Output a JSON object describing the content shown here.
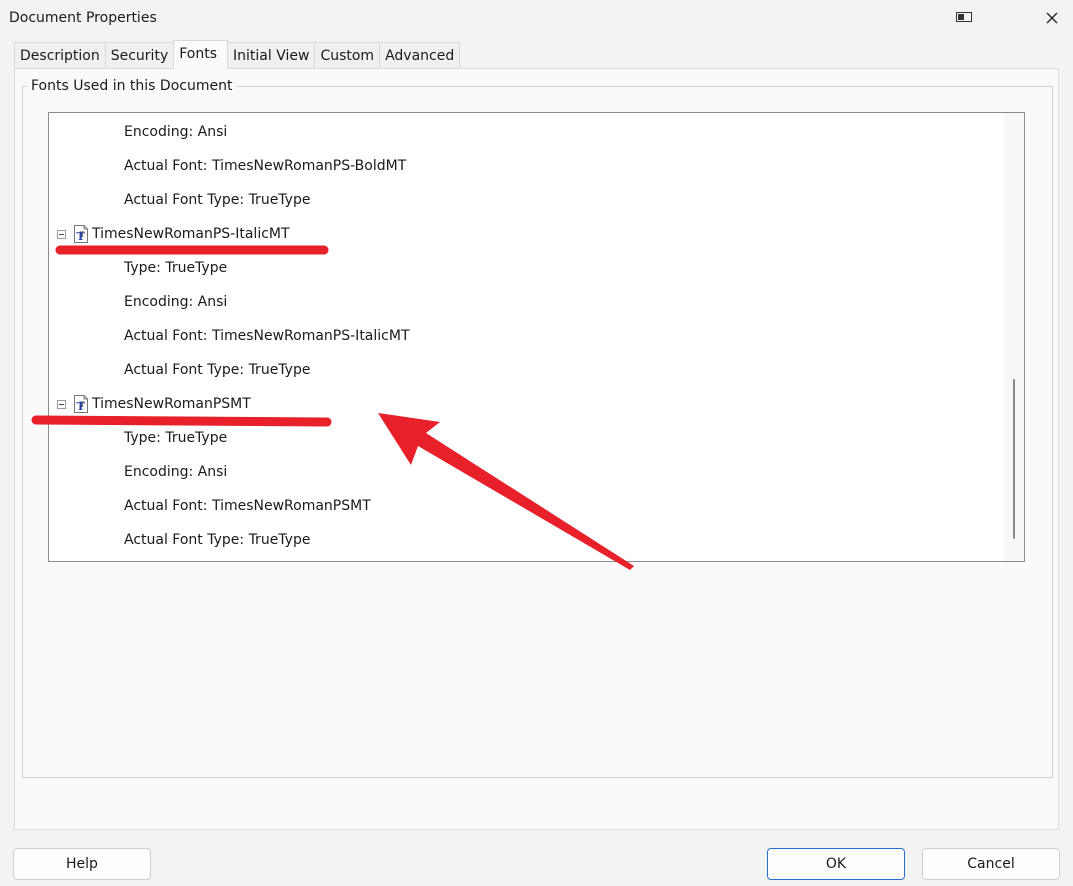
{
  "window": {
    "title": "Document Properties"
  },
  "tabs": [
    {
      "label": "Description"
    },
    {
      "label": "Security"
    },
    {
      "label": "Fonts"
    },
    {
      "label": "Initial View"
    },
    {
      "label": "Custom"
    },
    {
      "label": "Advanced"
    }
  ],
  "active_tab": "Fonts",
  "group": {
    "legend": "Fonts Used in this Document"
  },
  "tree": {
    "rows": [
      {
        "kind": "child",
        "text": "Encoding: Ansi"
      },
      {
        "kind": "child",
        "text": "Actual Font: TimesNewRomanPS-BoldMT"
      },
      {
        "kind": "child",
        "text": "Actual Font Type: TrueType"
      },
      {
        "kind": "parent",
        "text": "TimesNewRomanPS-ItalicMT",
        "expander": "collapse-icon",
        "icon": "truetype-font-icon"
      },
      {
        "kind": "child",
        "text": "Type: TrueType"
      },
      {
        "kind": "child",
        "text": "Encoding: Ansi"
      },
      {
        "kind": "child",
        "text": "Actual Font: TimesNewRomanPS-ItalicMT"
      },
      {
        "kind": "child",
        "text": "Actual Font Type: TrueType"
      },
      {
        "kind": "parent",
        "text": "TimesNewRomanPSMT",
        "expander": "collapse-icon",
        "icon": "truetype-font-icon"
      },
      {
        "kind": "child",
        "text": "Type: TrueType"
      },
      {
        "kind": "child",
        "text": "Encoding: Ansi"
      },
      {
        "kind": "child",
        "text": "Actual Font: TimesNewRomanPSMT"
      },
      {
        "kind": "child",
        "text": "Actual Font Type: TrueType"
      }
    ]
  },
  "buttons": {
    "help": "Help",
    "ok": "OK",
    "cancel": "Cancel"
  },
  "icons": {
    "snap": "snap-layout-icon",
    "close": "close-icon"
  },
  "colors": {
    "annotation": "#e8202a",
    "ok_border": "#2a6fd0",
    "font_icon_text": "#1f3fb8"
  }
}
